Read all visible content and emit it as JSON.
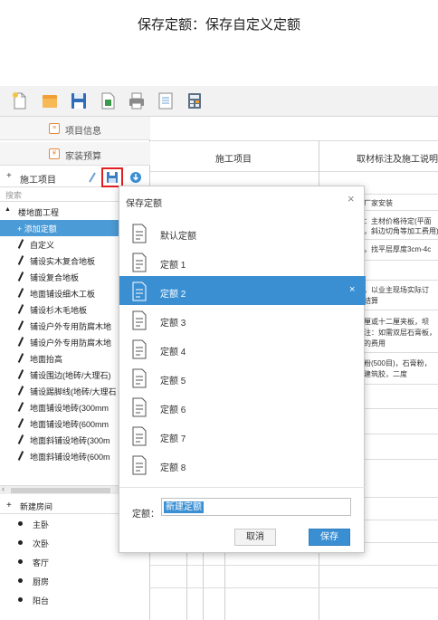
{
  "page_title": "保存定额：保存自定义定额",
  "toolbar": {
    "icons": [
      "new-file-icon",
      "open-folder-icon",
      "save-disk-icon",
      "excel-icon",
      "print-icon",
      "list-icon",
      "calculator-icon"
    ]
  },
  "left_panel": {
    "tabs": [
      {
        "label": "项目信息",
        "icon": "project-info-icon"
      },
      {
        "label": "家装预算",
        "icon": "budget-icon"
      }
    ],
    "section": {
      "plus": "+",
      "label": "施工项目",
      "actions": [
        "edit-icon",
        "save-icon",
        "download-icon"
      ]
    },
    "search_placeholder": "搜索",
    "tree": {
      "group_toggle": "▲",
      "group_label": "楼地面工程",
      "items": [
        {
          "label": "+ 添加定额",
          "selected": true
        },
        {
          "label": "自定义"
        },
        {
          "label": "铺设实木复合地板"
        },
        {
          "label": "铺设复合地板"
        },
        {
          "label": "地面铺设细木工板"
        },
        {
          "label": "铺设杉木毛地板"
        },
        {
          "label": "铺设户外专用防腐木地"
        },
        {
          "label": "铺设户外专用防腐木地"
        },
        {
          "label": "地面抬高"
        },
        {
          "label": "铺设围边(地砖/大理石)"
        },
        {
          "label": "铺设踢脚线(地砖/大理石"
        },
        {
          "label": "地面铺设地砖(300mm"
        },
        {
          "label": "地面铺设地砖(600mm"
        },
        {
          "label": "地面斜铺设地砖(300m"
        },
        {
          "label": "地面斜铺设地砖(600m"
        }
      ]
    },
    "rooms_section": {
      "plus": "+",
      "label": "新建房间",
      "rooms": [
        "主卧",
        "次卧",
        "客厅",
        "厨房",
        "阳台"
      ]
    }
  },
  "table": {
    "col_headers": [
      "施工项目",
      "取材标注及施工说明"
    ],
    "snippets": [
      "厂家安装",
      "：主材价格待定(平面",
      "，斜边切角等加工费用)",
      "，找平层厚度3cm-4c",
      "，以业主现场实际订",
      "结算",
      "厘或十二厘夹板，坝",
      "注：如需双层石膏板，",
      "的费用",
      "粉(500目)，石膏粉，",
      "建筑胶，二度"
    ]
  },
  "modal": {
    "title": "保存定额",
    "close": "×",
    "items": [
      {
        "label": "默认定额"
      },
      {
        "label": "定额 1"
      },
      {
        "label": "定额 2",
        "active": true
      },
      {
        "label": "定额 3"
      },
      {
        "label": "定额 4"
      },
      {
        "label": "定额 5"
      },
      {
        "label": "定额 6"
      },
      {
        "label": "定额 7"
      },
      {
        "label": "定额 8"
      }
    ],
    "item_close": "×",
    "name_label": "定额：",
    "name_value": "新建定额",
    "cancel_label": "取消",
    "save_label": "保存"
  },
  "colors": {
    "accent": "#3a8fd3",
    "highlight_border": "#e02020",
    "tree_selected": "#4b9bd6"
  }
}
